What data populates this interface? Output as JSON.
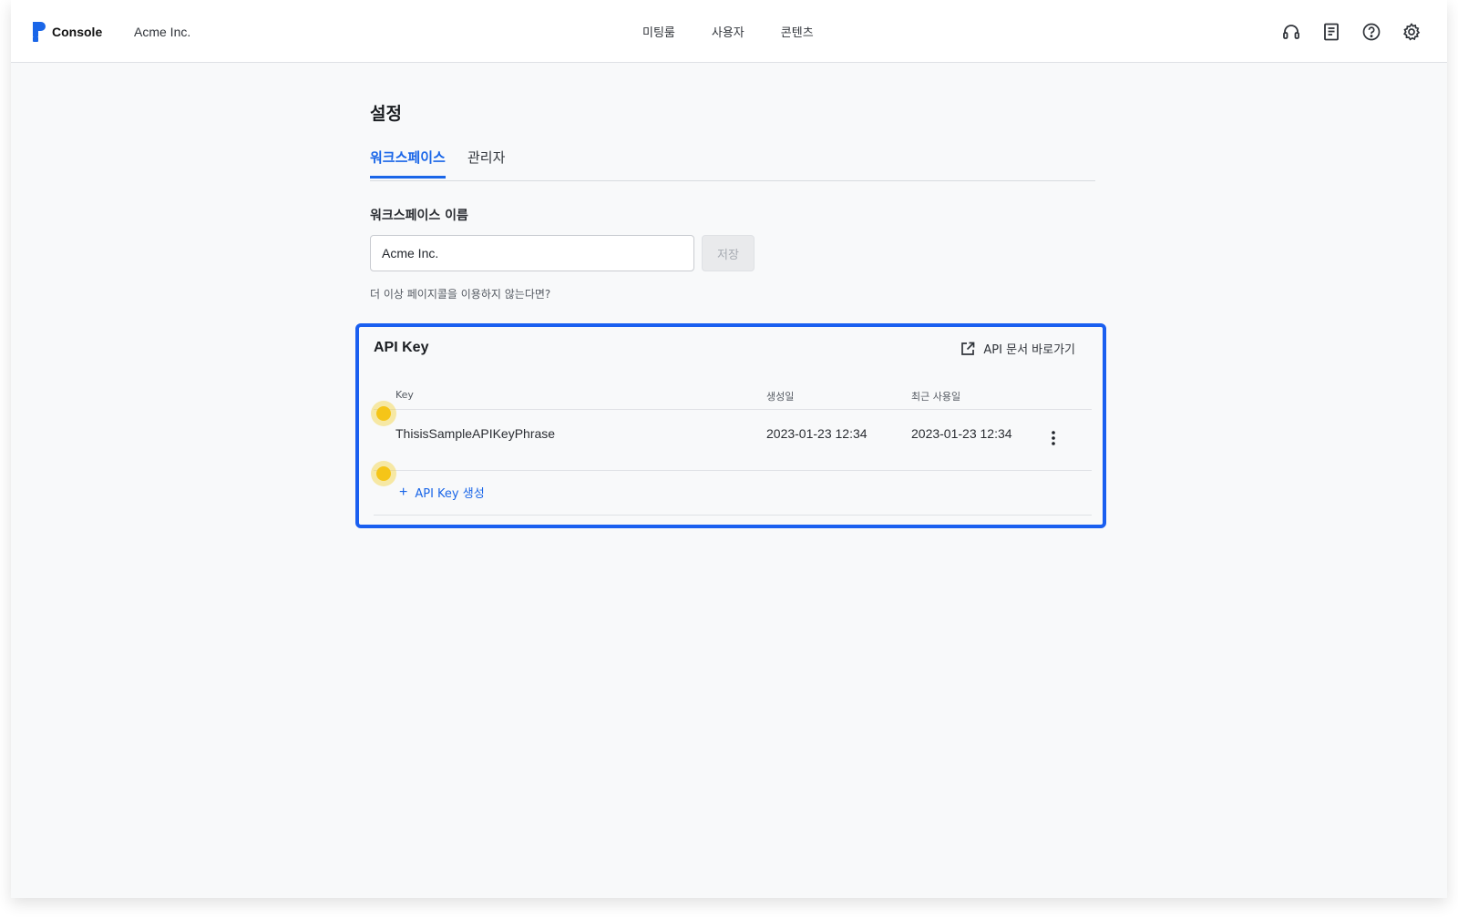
{
  "header": {
    "brand": "Console",
    "org_name": "Acme Inc.",
    "nav": [
      "미팅룸",
      "사용자",
      "콘텐츠"
    ],
    "tools": [
      "headset-icon",
      "document-icon",
      "help-icon",
      "gear-icon"
    ]
  },
  "page": {
    "title": "설정",
    "tabs": [
      {
        "label": "워크스페이스",
        "active": true
      },
      {
        "label": "관리자",
        "active": false
      }
    ],
    "workspace_name_label": "워크스페이스 이름",
    "workspace_name_value": "Acme Inc.",
    "save_label": "저장",
    "leave_link": "더 이상 페이지콜을 이용하지 않는다면?"
  },
  "api": {
    "title": "API Key",
    "doc_link": "API 문서 바로가기",
    "columns": {
      "key": "Key",
      "created": "생성일",
      "last_used": "최근 사용일"
    },
    "rows": [
      {
        "key": "ThisisSampleAPIKeyPhrase",
        "created": "2023-01-23 12:34",
        "last_used": "2023-01-23 12:34"
      }
    ],
    "add_label": "API Key 생성"
  },
  "colors": {
    "accent": "#1a66e8",
    "highlight_border": "#1a5ff0",
    "marker": "#f5c518"
  }
}
